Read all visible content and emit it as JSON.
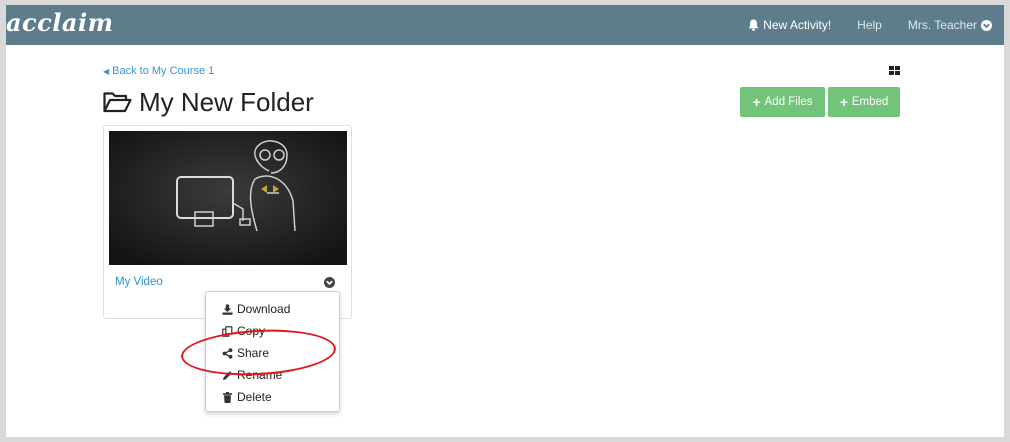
{
  "navbar": {
    "logo": "acclaim",
    "new_activity": "New Activity!",
    "help": "Help",
    "user": "Mrs. Teacher"
  },
  "page": {
    "back_link": "Back to My Course 1",
    "title": "My New Folder"
  },
  "actions": {
    "add_files": "Add Files",
    "embed": "Embed"
  },
  "video": {
    "title": "My Video"
  },
  "menu": {
    "items": [
      {
        "label": "Download",
        "icon": "download-icon"
      },
      {
        "label": "Copy",
        "icon": "copy-icon"
      },
      {
        "label": "Share",
        "icon": "share-icon"
      },
      {
        "label": "Rename",
        "icon": "pencil-icon"
      },
      {
        "label": "Delete",
        "icon": "trash-icon"
      }
    ]
  },
  "colors": {
    "navbar": "#5d7d8c",
    "accent_green": "#72c47a",
    "link_blue": "#3a92cf",
    "annotation_red": "#e0161d"
  }
}
